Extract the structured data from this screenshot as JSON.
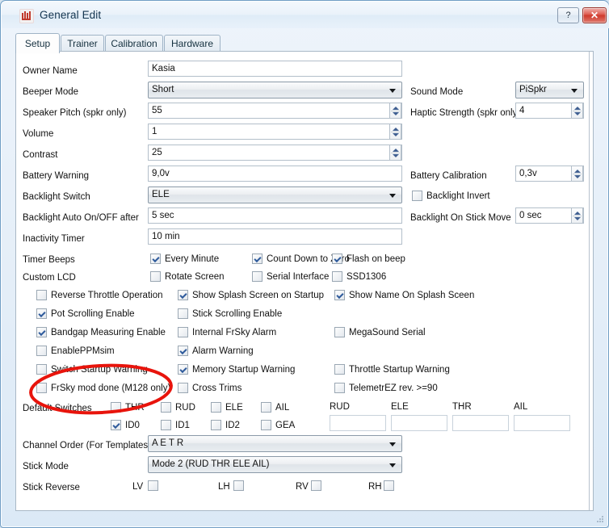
{
  "window": {
    "title": "General Edit",
    "app_icon": "companion-icon",
    "help_label": "?",
    "close_label": "✕"
  },
  "tabs": [
    {
      "label": "Setup",
      "active": true
    },
    {
      "label": "Trainer",
      "active": false
    },
    {
      "label": "Calibration",
      "active": false
    },
    {
      "label": "Hardware",
      "active": false
    }
  ],
  "setup": {
    "owner_name": {
      "label": "Owner Name",
      "value": "Kasia"
    },
    "beeper_mode": {
      "label": "Beeper Mode",
      "value": "Short"
    },
    "speaker_pitch": {
      "label": "Speaker Pitch (spkr only)",
      "value": "55"
    },
    "volume": {
      "label": "Volume",
      "value": "1"
    },
    "contrast": {
      "label": "Contrast",
      "value": "25"
    },
    "battery_warning": {
      "label": "Battery Warning",
      "value": "9,0v"
    },
    "backlight_switch": {
      "label": "Backlight Switch",
      "value": "ELE"
    },
    "backlight_auto": {
      "label": "Backlight Auto On/OFF after",
      "value": "5 sec"
    },
    "inactivity_timer": {
      "label": "Inactivity Timer",
      "value": "10 min"
    },
    "sound_mode": {
      "label": "Sound Mode",
      "value": "PiSpkr"
    },
    "haptic_strength": {
      "label": "Haptic Strength (spkr only)",
      "value": "4"
    },
    "battery_calibration": {
      "label": "Battery Calibration",
      "value": "0,3v"
    },
    "backlight_invert": {
      "label": "Backlight Invert",
      "checked": false
    },
    "backlight_stick_move": {
      "label": "Backlight On Stick Move",
      "value": "0 sec"
    },
    "timer_beeps": {
      "label": "Timer Beeps",
      "options": [
        {
          "label": "Every Minute",
          "checked": true
        },
        {
          "label": "Count Down to Zero",
          "checked": true
        },
        {
          "label": "Flash on beep",
          "checked": true
        }
      ]
    },
    "custom_lcd": {
      "label": "Custom LCD",
      "options": [
        {
          "label": "Rotate Screen",
          "checked": false
        },
        {
          "label": "Serial Interface",
          "checked": false
        },
        {
          "label": "SSD1306",
          "checked": false
        }
      ]
    },
    "option_rows": [
      [
        {
          "label": "Reverse Throttle Operation",
          "checked": false
        },
        {
          "label": "Show Splash Screen on Startup",
          "checked": true
        },
        {
          "label": "Show Name On Splash Sceen",
          "checked": true
        }
      ],
      [
        {
          "label": "Pot Scrolling Enable",
          "checked": true
        },
        {
          "label": "Stick Scrolling Enable",
          "checked": false
        },
        null
      ],
      [
        {
          "label": "Bandgap Measuring Enable",
          "checked": true
        },
        {
          "label": "Internal FrSky Alarm",
          "checked": false
        },
        {
          "label": "MegaSound Serial",
          "checked": false
        }
      ],
      [
        {
          "label": "EnablePPMsim",
          "checked": false
        },
        {
          "label": "Alarm Warning",
          "checked": true
        },
        null
      ],
      [
        {
          "label": "Switch Startup Warning",
          "checked": false
        },
        {
          "label": "Memory Startup Warning",
          "checked": true
        },
        {
          "label": "Throttle Startup Warning",
          "checked": false
        }
      ],
      [
        {
          "label": "FrSky mod done (M128 only)",
          "checked": false
        },
        {
          "label": "Cross Trims",
          "checked": false
        },
        {
          "label": "TelemetrEZ rev. >=90",
          "checked": false
        }
      ]
    ],
    "default_switches": {
      "label": "Default Switches",
      "row1": [
        {
          "label": "THR",
          "checked": false
        },
        {
          "label": "RUD",
          "checked": false
        },
        {
          "label": "ELE",
          "checked": false
        },
        {
          "label": "AIL",
          "checked": false
        }
      ],
      "row2": [
        {
          "label": "ID0",
          "checked": true
        },
        {
          "label": "ID1",
          "checked": false
        },
        {
          "label": "ID2",
          "checked": false
        },
        {
          "label": "GEA",
          "checked": false
        }
      ]
    },
    "trim_fields": [
      {
        "label": "RUD",
        "value": ""
      },
      {
        "label": "ELE",
        "value": ""
      },
      {
        "label": "THR",
        "value": ""
      },
      {
        "label": "AIL",
        "value": ""
      }
    ],
    "channel_order": {
      "label": "Channel Order (For Templates)",
      "value": "A E T R"
    },
    "stick_mode": {
      "label": "Stick Mode",
      "value": "Mode 2 (RUD THR ELE AIL)"
    },
    "stick_reverse": {
      "label": "Stick Reverse",
      "options": [
        {
          "label": "LV",
          "checked": false
        },
        {
          "label": "LH",
          "checked": false
        },
        {
          "label": "RV",
          "checked": false
        },
        {
          "label": "RH",
          "checked": false
        }
      ]
    }
  },
  "annotation": {
    "shape": "red-ellipse",
    "color": "#e8140c",
    "target": "FrSky mod done (M128 only)"
  }
}
